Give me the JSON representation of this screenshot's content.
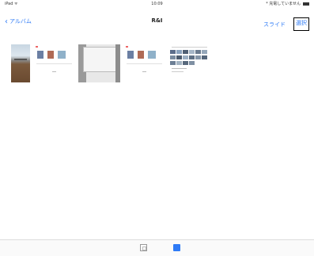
{
  "status": {
    "carrier": "iPad ᯤ",
    "time": "10:09",
    "right": "* 充電していません"
  },
  "nav": {
    "back_label": "アルバム",
    "title": "R&I",
    "slideshow_label": "スライド",
    "select_label": "選択"
  },
  "thumbnails": [
    {
      "kind": "photo",
      "name": "street-photo"
    },
    {
      "kind": "document",
      "name": "screenshot-doc-1"
    },
    {
      "kind": "document",
      "name": "screenshot-doc-2"
    },
    {
      "kind": "document",
      "name": "screenshot-doc-3"
    },
    {
      "kind": "document",
      "name": "screenshot-doc-4"
    }
  ],
  "toolbar": {
    "icons": [
      "grid-view-icon",
      "photos-view-icon"
    ]
  },
  "colors": {
    "accent": "#2f7bf6"
  }
}
